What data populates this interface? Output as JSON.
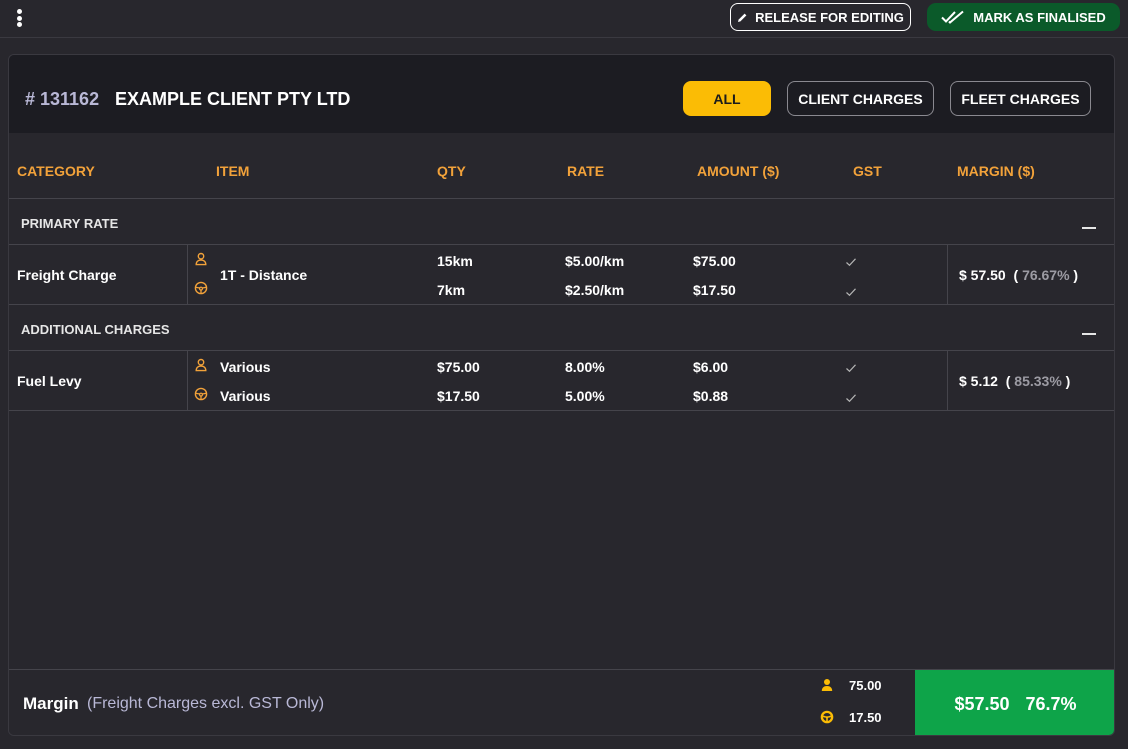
{
  "toolbar": {
    "release_label": "RELEASE FOR EDITING",
    "finalise_label": "MARK AS FINALISED"
  },
  "job": {
    "number": "# 131162",
    "client": "EXAMPLE CLIENT PTY LTD"
  },
  "filters": {
    "all": "ALL",
    "client": "CLIENT CHARGES",
    "fleet": "FLEET CHARGES",
    "active": "ALL"
  },
  "columns": {
    "category": "CATEGORY",
    "item": "ITEM",
    "qty": "QTY",
    "rate": "RATE",
    "amount": "AMOUNT ($)",
    "gst": "GST",
    "margin": "MARGIN ($)"
  },
  "sections": [
    {
      "title": "PRIMARY RATE",
      "rows": [
        {
          "category": "Freight Charge",
          "item": "1T - Distance",
          "client_line": {
            "qty": "15km",
            "rate": "$5.00/km",
            "amount": "$75.00",
            "gst": true
          },
          "fleet_line": {
            "qty": "7km",
            "rate": "$2.50/km",
            "amount": "$17.50",
            "gst": true
          },
          "margin": "$ 57.50",
          "margin_pct": "76.67%"
        }
      ]
    },
    {
      "title": "ADDITIONAL CHARGES",
      "rows": [
        {
          "category": "Fuel Levy",
          "client_line": {
            "item": "Various",
            "qty": "$75.00",
            "rate": "8.00%",
            "amount": "$6.00",
            "gst": true
          },
          "fleet_line": {
            "item": "Various",
            "qty": "$17.50",
            "rate": "5.00%",
            "amount": "$0.88",
            "gst": true
          },
          "margin": "$ 5.12",
          "margin_pct": "85.33%"
        }
      ]
    }
  ],
  "footer": {
    "label": "Margin",
    "sublabel": "(Freight Charges excl. GST Only)",
    "client_total": "75.00",
    "fleet_total": "17.50",
    "margin_amount": "$57.50",
    "margin_pct": "76.7%"
  },
  "icons": {
    "client": "person-icon",
    "fleet": "steering-wheel-icon",
    "gst": "check-icon"
  },
  "colors": {
    "accent": "#fbbc05",
    "header_text": "#f2a23a",
    "success": "#0ea449",
    "finalise_bg": "#0b5a2a",
    "background": "#28272d",
    "panel_header": "#1c1c22"
  }
}
